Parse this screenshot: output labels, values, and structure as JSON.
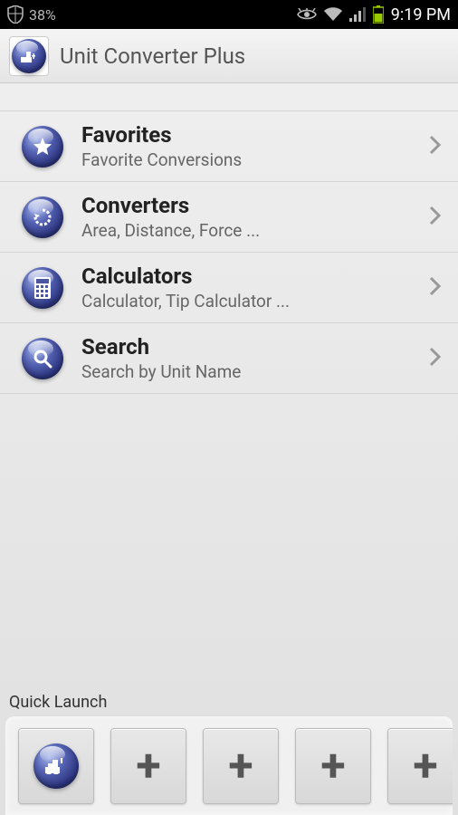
{
  "status": {
    "battery_pct": "38%",
    "time": "9:19 PM"
  },
  "app": {
    "title": "Unit Converter Plus"
  },
  "menu": [
    {
      "title": "Favorites",
      "sub": "Favorite Conversions",
      "icon": "star"
    },
    {
      "title": "Converters",
      "sub": "Area, Distance, Force ...",
      "icon": "cycle"
    },
    {
      "title": "Calculators",
      "sub": "Calculator, Tip Calculator ...",
      "icon": "calculator"
    },
    {
      "title": "Search",
      "sub": "Search by Unit Name",
      "icon": "search"
    }
  ],
  "quick_launch": {
    "label": "Quick Launch",
    "slots": [
      {
        "type": "app"
      },
      {
        "type": "add"
      },
      {
        "type": "add"
      },
      {
        "type": "add"
      },
      {
        "type": "add"
      }
    ]
  }
}
